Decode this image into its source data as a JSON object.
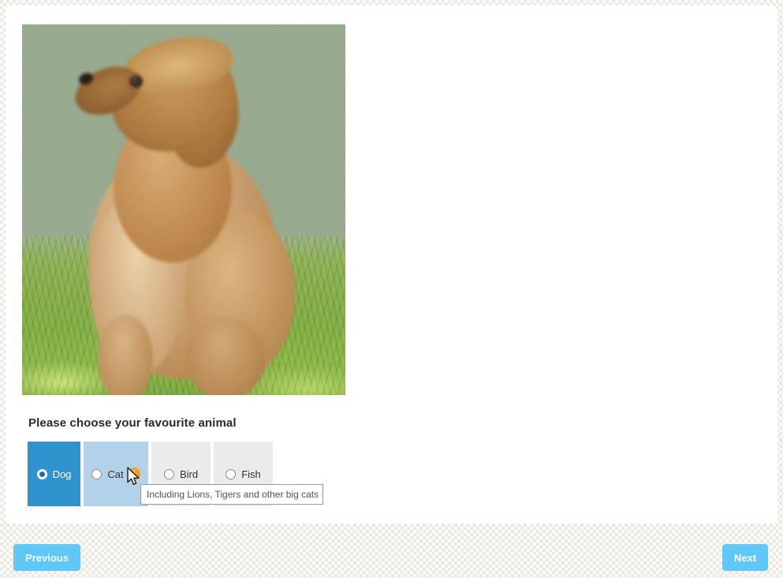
{
  "survey": {
    "image": {
      "alt": "Photograph of a tan cockapoo puppy sitting on grass",
      "subject": "dog",
      "setting": "grass"
    },
    "question": {
      "text": "Please choose your favourite animal"
    },
    "options": [
      {
        "label": "Dog",
        "state": "selected",
        "has_info": false,
        "background_color": "#3193cd"
      },
      {
        "label": "Cat",
        "state": "hovered",
        "has_info": true,
        "background_color": "#b3d1e8",
        "info_icon": "info-icon"
      },
      {
        "label": "Bird",
        "state": "normal",
        "has_info": false,
        "background_color": "#ebebeb"
      },
      {
        "label": "Fish",
        "state": "normal",
        "has_info": false,
        "background_color": "#ebebeb"
      }
    ],
    "tooltip": {
      "text": "Including Lions, Tigers and other big cats",
      "attached_to": "Cat"
    }
  },
  "footer": {
    "previous_label": "Previous",
    "next_label": "Next",
    "button_color": "#5fc8f8"
  },
  "cursor": {
    "type": "arrow-pointer"
  }
}
